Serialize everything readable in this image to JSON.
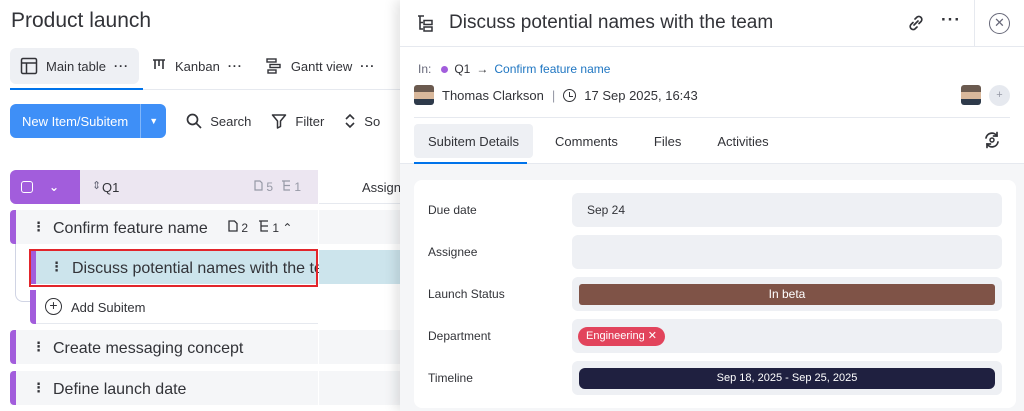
{
  "board": {
    "title": "Product launch",
    "views": [
      {
        "label": "Main table",
        "more": "···"
      },
      {
        "label": "Kanban",
        "more": "···"
      },
      {
        "label": "Gantt view",
        "more": "···"
      }
    ],
    "toolbar": {
      "new_item_label": "New Item/Subitem",
      "search_label": "Search",
      "filter_label": "Filter",
      "sort_label": "So"
    },
    "group": {
      "name": "Q1",
      "files_count": "5",
      "subitems_count": "1",
      "assignee_column": "Assignee"
    },
    "items": [
      {
        "name": "Confirm feature name",
        "files": "2",
        "subitems": "1"
      },
      {
        "name": "Create messaging concept"
      },
      {
        "name": "Define launch date"
      }
    ],
    "subitem": {
      "name": "Discuss potential names with the team"
    },
    "add_subitem_label": "Add Subitem"
  },
  "panel": {
    "title": "Discuss potential names with the team",
    "breadcrumb": {
      "prefix": "In:",
      "group": "Q1",
      "parent_link": "Confirm feature name"
    },
    "author": "Thomas Clarkson",
    "created": "17 Sep 2025, 16:43",
    "tabs": [
      "Subitem Details",
      "Comments",
      "Files",
      "Activities"
    ],
    "fields": {
      "due_date": {
        "label": "Due date",
        "value": "Sep 24"
      },
      "assignee": {
        "label": "Assignee",
        "value": ""
      },
      "launch_status": {
        "label": "Launch Status",
        "value": "In beta",
        "color": "#7f5347"
      },
      "department": {
        "label": "Department",
        "value": "Engineering",
        "color": "#e2445c"
      },
      "timeline": {
        "label": "Timeline",
        "value": "Sep 18, 2025 - Sep 25, 2025"
      }
    }
  },
  "colors": {
    "group_accent": "#a25ddc",
    "primary": "#3e8ff7",
    "selected_row": "#cce4ec",
    "highlight_border": "#e2252b"
  }
}
